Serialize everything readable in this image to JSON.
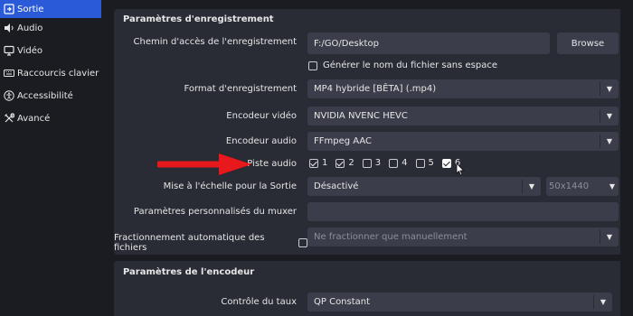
{
  "sidebar": {
    "items": [
      {
        "label": "Sortie",
        "icon": "output-icon",
        "active": true
      },
      {
        "label": "Audio",
        "icon": "speaker-icon",
        "active": false
      },
      {
        "label": "Vidéo",
        "icon": "monitor-icon",
        "active": false
      },
      {
        "label": "Raccourcis clavier",
        "icon": "keyboard-icon",
        "active": false
      },
      {
        "label": "Accessibilité",
        "icon": "accessibility-icon",
        "active": false
      },
      {
        "label": "Avancé",
        "icon": "tools-icon",
        "active": false
      }
    ]
  },
  "recording": {
    "title": "Paramètres d'enregistrement",
    "path_label": "Chemin d'accès de l'enregistrement",
    "path_value": "F:/GO/Desktop",
    "browse_label": "Browse",
    "nospace_label": "Générer le nom du fichier sans espace",
    "format_label": "Format d'enregistrement",
    "format_value": "MP4 hybride [BÊTA] (.mp4)",
    "video_encoder_label": "Encodeur vidéo",
    "video_encoder_value": "NVIDIA NVENC HEVC",
    "audio_encoder_label": "Encodeur audio",
    "audio_encoder_value": "FFmpeg AAC",
    "tracks_label": "Piste audio",
    "tracks": [
      {
        "number": "1",
        "checked": true
      },
      {
        "number": "2",
        "checked": true
      },
      {
        "number": "3",
        "checked": false
      },
      {
        "number": "4",
        "checked": false
      },
      {
        "number": "5",
        "checked": false
      },
      {
        "number": "6",
        "checked": true
      }
    ],
    "rescale_label": "Mise à l'échelle pour la Sortie",
    "rescale_value": "Désactivé",
    "rescale_resolution": "50x1440",
    "muxer_label": "Paramètres personnalisés du muxer",
    "muxer_value": "",
    "split_label": "Fractionnement automatique des fichiers",
    "split_value": "Ne fractionner que manuellement"
  },
  "encoder": {
    "title": "Paramètres de l'encodeur",
    "rate_control_label": "Contrôle du taux",
    "rate_control_value": "QP Constant"
  },
  "colors": {
    "accent": "#2a5ad8",
    "annotation_arrow": "#e8191c"
  }
}
